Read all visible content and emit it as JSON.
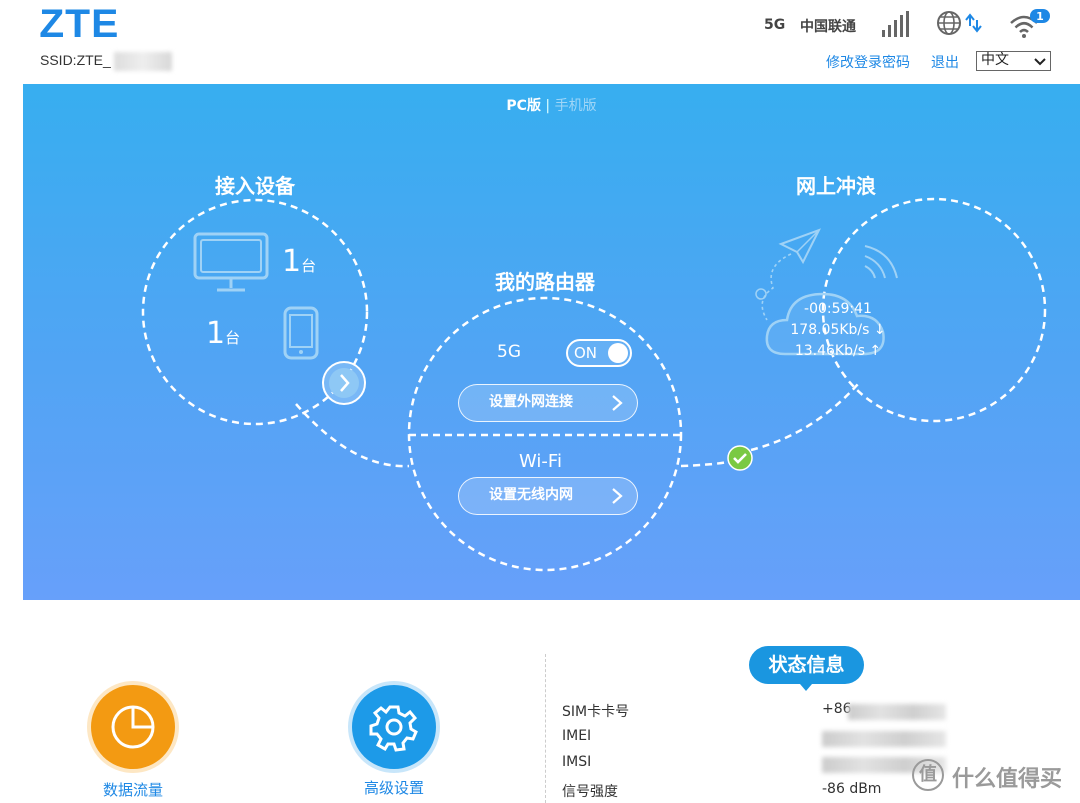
{
  "header": {
    "logo": "ZTE",
    "ssid_label": "SSID:ZTE_",
    "network_type": "5G",
    "carrier": "中国联通",
    "wifi_clients": "1",
    "change_password": "修改登录密码",
    "logout": "退出",
    "language": "中文"
  },
  "banner": {
    "view_pc": "PC版",
    "view_sep": " | ",
    "view_mobile": "手机版",
    "devices": {
      "title": "接入设备",
      "pc_count": "1",
      "mobile_count": "1",
      "unit": "台"
    },
    "router": {
      "title": "我的路由器",
      "band_label": "5G",
      "toggle_state": "ON",
      "wan_button": "设置外网连接",
      "wifi_label": "Wi-Fi",
      "wlan_button": "设置无线内网"
    },
    "internet": {
      "title": "网上冲浪",
      "duration": "-00:59:41",
      "download": "178.05Kb/s ↓",
      "upload": "13.46Kb/s ↑"
    }
  },
  "bottom": {
    "data_usage": "数据流量",
    "advanced_settings": "高级设置",
    "status_title": "状态信息",
    "rows": [
      {
        "label": "SIM卡卡号",
        "value": "+86"
      },
      {
        "label": "IMEI",
        "value": ""
      },
      {
        "label": "IMSI",
        "value": ""
      },
      {
        "label": "信号强度",
        "value": "-86 dBm"
      }
    ]
  },
  "watermark": {
    "symbol": "值",
    "text": "什么值得买"
  },
  "colors": {
    "brand": "#1e88e5",
    "banner_top": "#37aef0",
    "banner_bottom": "#67a0fa",
    "data_button": "#f39a12",
    "advanced_button": "#1d9ae8",
    "status_pill": "#1a96e0",
    "connected_check": "#7ac943"
  }
}
